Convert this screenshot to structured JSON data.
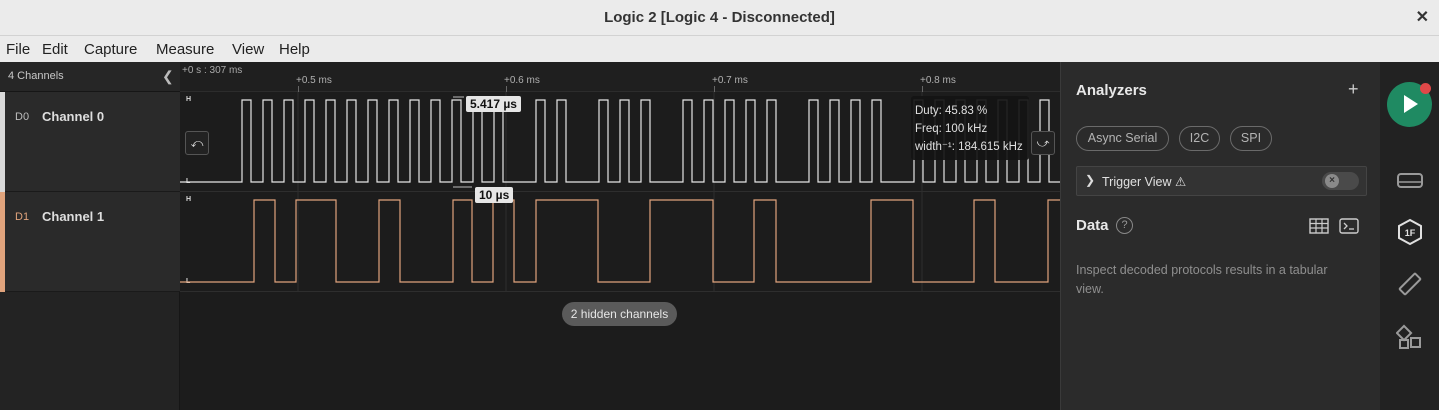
{
  "window": {
    "title": "Logic 2 [Logic 4 - Disconnected]",
    "close_glyph": "✕"
  },
  "menu": [
    "File",
    "Edit",
    "Capture",
    "Measure",
    "View",
    "Help"
  ],
  "sidebar": {
    "header": "4 Channels",
    "channels": [
      {
        "id": "D0",
        "name": "Channel 0",
        "color": "#d9d9d9"
      },
      {
        "id": "D1",
        "name": "Channel 1",
        "color": "#e0a37c"
      }
    ]
  },
  "timeline": {
    "origin": "+0 s : 307 ms",
    "ticks": [
      "+0.5 ms",
      "+0.6 ms",
      "+0.7 ms",
      "+0.8 ms"
    ],
    "level_high": "H",
    "level_low": "L",
    "hidden_channels": "2 hidden channels",
    "measurement_top": "5.417 µs",
    "measurement_bottom": "10 µs",
    "prev_edge_glyph": "⤺",
    "next_edge_glyph": "⤻"
  },
  "tooltip": {
    "duty": "Duty: 45.83 %",
    "freq": "Freq: 100 kHz",
    "width": "width⁻¹: 184.615 kHz"
  },
  "analyzers": {
    "title": "Analyzers",
    "add_glyph": "+",
    "chips": [
      "Async Serial",
      "I2C",
      "SPI"
    ],
    "trigger_view": "Trigger View ⚠",
    "data_title": "Data",
    "help_glyph": "?",
    "data_description": "Inspect decoded protocols results in a tabular view."
  },
  "rail": {
    "one_f": "1F"
  },
  "colors": {
    "run": "#1f8a62",
    "record_dot": "#e04848",
    "channel1": "#e0a37c"
  },
  "icons": [
    "play-icon",
    "device-icon",
    "analyzer-1f-icon",
    "ruler-icon",
    "extensions-icon",
    "table-icon",
    "terminal-icon",
    "chevron-left-icon",
    "chevron-right-icon",
    "plus-icon",
    "help-icon",
    "warning-icon"
  ]
}
